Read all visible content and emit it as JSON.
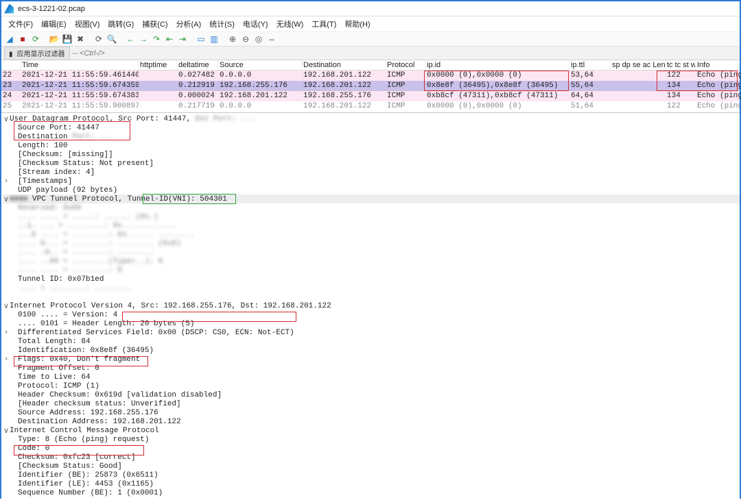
{
  "window": {
    "title": "ecs-3-1221-02.pcap"
  },
  "menu": [
    "文件(F)",
    "编辑(E)",
    "视图(V)",
    "跳转(G)",
    "捕获(C)",
    "分析(A)",
    "统计(S)",
    "电话(Y)",
    "无线(W)",
    "工具(T)",
    "帮助(H)"
  ],
  "filter": {
    "label": "应用显示过滤器",
    "placeholder": "<Ctrl-/>"
  },
  "columns": {
    "time": "Time",
    "httptime": "httptime",
    "deltatime": "deltatime",
    "source": "Source",
    "destination": "Destination",
    "protocol": "Protocol",
    "ipid": "ip.id",
    "ttl": "ip.ttl",
    "spdp": "sp dp se ac Leng",
    "len": "tc tc st wi wi wi",
    "info": "Info"
  },
  "rows": [
    {
      "no": "22",
      "time": "2021-12-21 11:55:59.461440",
      "deltatime": "0.027482",
      "src": "0.0.0.0",
      "dst": "192.168.201.122",
      "proto": "ICMP",
      "ipid": "0x0000 (0),0x0000 (0)",
      "ttl": "53,64",
      "len": "122",
      "info": "Echo (ping) request"
    },
    {
      "no": "23",
      "time": "2021-12-21 11:55:59.674359",
      "deltatime": "0.212919",
      "src": "192.168.255.176",
      "dst": "192.168.201.122",
      "proto": "ICMP",
      "ipid": "0x8e8f (36495),0x8e8f (36495)",
      "ttl": "55,64",
      "len": "134",
      "info": "Echo (ping) request"
    },
    {
      "no": "24",
      "time": "2021-12-21 11:55:59.674383",
      "deltatime": "0.000024",
      "src": "192.168.201.122",
      "dst": "192.168.255.176",
      "proto": "ICMP",
      "ipid": "0xb8cf (47311),0xb8cf (47311)",
      "ttl": "64,64",
      "len": "134",
      "info": "Echo (ping) reply"
    },
    {
      "no": "25",
      "time": "2021-12-21 11:55:59.900897",
      "deltatime": "0.217719",
      "src": "0.0.0.0",
      "dst": "192.168.201.122",
      "proto": "ICMP",
      "ipid": "0x0000 (0),0x0000 (0)",
      "ttl": "51,64",
      "len": "122",
      "info": "Echo (ping) request"
    }
  ],
  "udp": {
    "header": "User Datagram Protocol, Src Port: 41447, ",
    "header_blur": "Dst Port: ...",
    "src_port": "Source Port: 41447",
    "dst_port_label": "Destination ",
    "dst_port_blur": "Port: ...",
    "length": "Length: 100",
    "checksum": "[Checksum: [missing]]",
    "checksum_status": "[Checksum Status: Not present]",
    "stream": "[Stream index: 4]",
    "timestamps": "[Timestamps]",
    "payload": "UDP payload (92 bytes)"
  },
  "vpc": {
    "header_pre": "VPC Tunnel Protocol, ",
    "tunnel_id_label": "Tunnel-ID(VNI): 504301",
    "tunnel_id_line": "Tunnel ID: 0x07b1ed"
  },
  "ipv4": {
    "header": "Internet Protocol Version 4, ",
    "srcdst": "Src: 192.168.255.176, Dst: 192.168.201.122",
    "version": "0100 .... = Version: 4",
    "hlen": ".... 0101 = Header Length: 20 bytes (5)",
    "dsf": "Differentiated Services Field: 0x00 (DSCP: CS0, ECN: Not-ECT)",
    "tlen": "Total Length: 84",
    "ident": "Identification: 0x8e8f (36495)",
    "flags": "Flags: 0x40, Don't fragment",
    "fragoff": "Fragment Offset: 0",
    "ttl": "Time to Live: 64",
    "proto": "Protocol: ICMP (1)",
    "hcs": "Header Checksum: 0x619d [validation disabled]",
    "hcs_status": "[Header checksum status: Unverified]",
    "saddr": "Source Address: 192.168.255.176",
    "daddr": "Destination Address: 192.168.201.122"
  },
  "icmp": {
    "header": "Internet Control Message Protocol",
    "type": "Type: 8 (Echo (ping) request)",
    "code": "Code: 0",
    "checksum": "Checksum: 0xfc23 [correct]",
    "cs_status": "[Checksum Status: Good]",
    "id_be": "Identifier (BE): 25873 (0x6511)",
    "id_le": "Identifier (LE): 4453 (0x1165)",
    "seq_be": "Sequence Number (BE): 1 (0x0001)"
  }
}
